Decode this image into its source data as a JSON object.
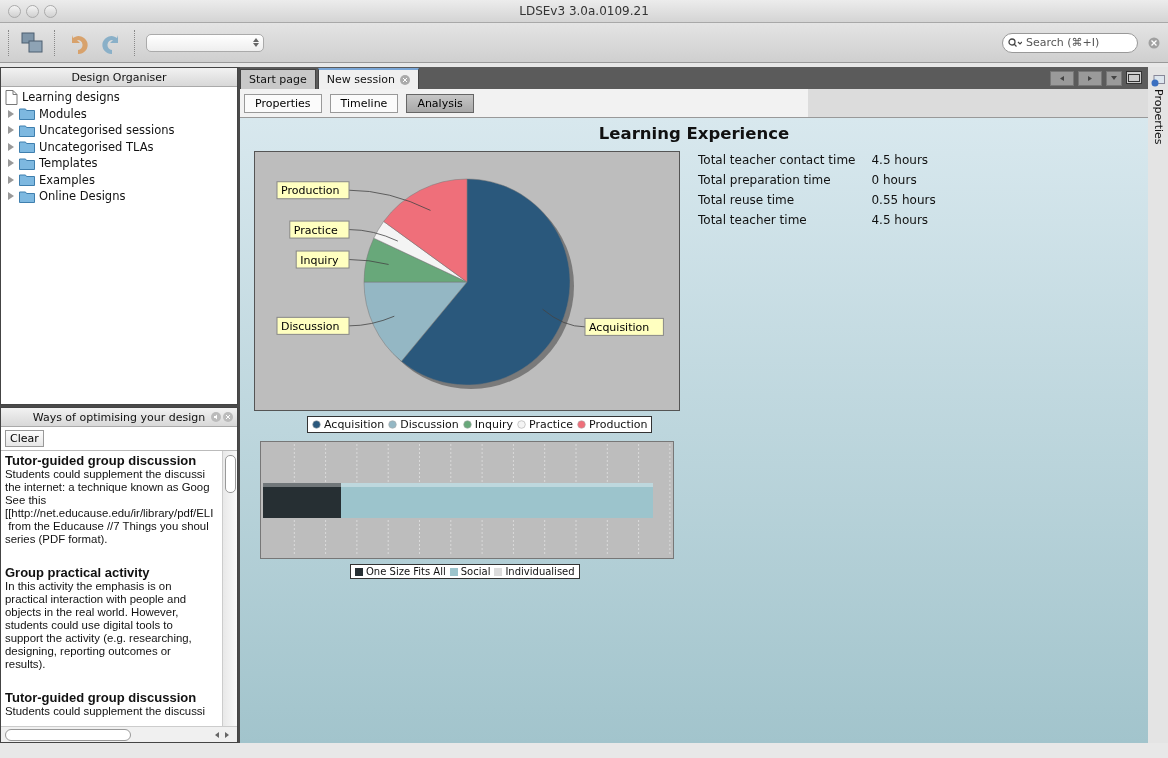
{
  "window": {
    "title": "LDSEv3 3.0a.0109.21"
  },
  "toolbar": {
    "search": {
      "placeholder": "Search (⌘+I)"
    }
  },
  "design_organiser": {
    "title": "Design Organiser",
    "items": [
      {
        "label": "Learning designs",
        "kind": "document"
      },
      {
        "label": "Modules",
        "kind": "folder",
        "expanded": false
      },
      {
        "label": "Uncategorised sessions",
        "kind": "folder",
        "expanded": false
      },
      {
        "label": "Uncategorised TLAs",
        "kind": "folder",
        "expanded": false
      },
      {
        "label": "Templates",
        "kind": "folder",
        "expanded": false
      },
      {
        "label": "Examples",
        "kind": "folder",
        "expanded": false
      },
      {
        "label": "Online Designs",
        "kind": "folder",
        "expanded": false
      }
    ]
  },
  "hints_panel": {
    "title": "Ways of optimising your design",
    "clear_button": "Clear",
    "entries": [
      {
        "heading": "Tutor-guided group discussion",
        "body": "Students could supplement the discussi\nthe internet: a technique known as Goog\nSee this\n[[http://net.educause.edu/ir/library/pdf/ELI\n from the Educause //7 Things you shoul\nseries (PDF format)."
      },
      {
        "heading": "Group practical activity",
        "body": "In this activity the emphasis is on\npractical interaction with people and\nobjects in the real world. However,\nstudents could use digital tools to\nsupport the activity (e.g. researching,\ndesigning, reporting outcomes or\nresults)."
      },
      {
        "heading": "Tutor-guided group discussion",
        "body": "Students could supplement the discussi"
      }
    ]
  },
  "tabs": [
    {
      "label": "Start page",
      "selected": false
    },
    {
      "label": "New session",
      "selected": true
    }
  ],
  "view_buttons": [
    {
      "label": "Properties",
      "selected": false
    },
    {
      "label": "Timeline",
      "selected": false
    },
    {
      "label": "Analysis",
      "selected": true
    }
  ],
  "analysis": {
    "title": "Learning Experience",
    "pie_chart": {
      "chart_data": {
        "type": "pie",
        "categories": [
          "Acquisition",
          "Discussion",
          "Inquiry",
          "Practice",
          "Production"
        ],
        "series": [
          {
            "colors": [
              "#2a587c",
              "#94b7c4",
              "#68a87a",
              "#f4f4f4",
              "#ef6f7a"
            ],
            "values": [
              0.61,
              0.14,
              0.07,
              0.03,
              0.15
            ]
          }
        ]
      }
    },
    "bar_chart": {
      "segments": [
        {
          "name": "One Size Fits All",
          "color": "#262f33",
          "level": 0.19
        },
        {
          "name": "Social",
          "color": "#9cc4cc",
          "level": 0.95
        },
        {
          "name": "Individualised",
          "color": "#dcdcdc"
        }
      ]
    },
    "stats": [
      {
        "label": "Total teacher contact time",
        "value": "4.5 hours"
      },
      {
        "label": "Total preparation time",
        "value": "0 hours"
      },
      {
        "label": "Total reuse time",
        "value": "0.55 hours"
      },
      {
        "label": "Total teacher time",
        "value": "4.5 hours"
      }
    ]
  },
  "side_tab": {
    "label": "Properties"
  }
}
